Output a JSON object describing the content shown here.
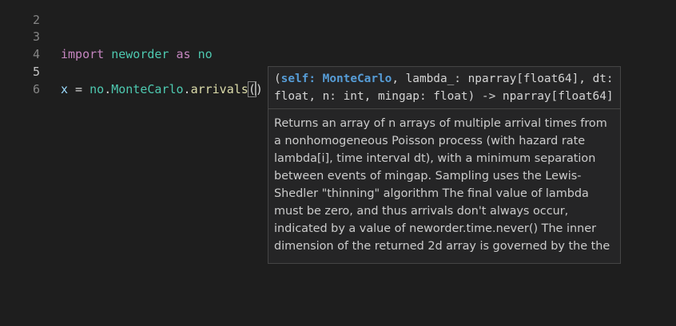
{
  "editor": {
    "lines": [
      {
        "number": "2"
      },
      {
        "number": "3",
        "import_kw": "import",
        "module": "neworder",
        "as_kw": "as",
        "alias": "no"
      },
      {
        "number": "4"
      },
      {
        "number": "5",
        "var": "x",
        "eq": " = ",
        "alias": "no",
        "dot1": ".",
        "cls": "MonteCarlo",
        "dot2": ".",
        "method": "arrivals",
        "open_paren": "(",
        "close_paren": ")"
      },
      {
        "number": "6"
      }
    ]
  },
  "hover": {
    "sig_open": "(",
    "sig_self": "self:",
    "sig_cls": "MonteCarlo",
    "sig_rest": ", lambda_: nparray[float64], dt: float, n: int, mingap: float) -> nparray[float64]",
    "doc": "Returns an array of n arrays of multiple arrival times from a nonhomogeneous Poisson process (with hazard rate lambda[i], time interval dt), with a minimum separation between events of mingap. Sampling uses the Lewis-Shedler \"thinning\" algorithm The final value of lambda must be zero, and thus arrivals don't always occur, indicated by a value of neworder.time.never() The inner dimension of the returned 2d array is governed by the the"
  },
  "colors": {
    "background": "#1e1e1e",
    "keyword": "#c586c0",
    "type": "#4ec9b0",
    "function": "#dcdcaa",
    "variable": "#9cdcfe",
    "hover_bg": "#252526"
  }
}
